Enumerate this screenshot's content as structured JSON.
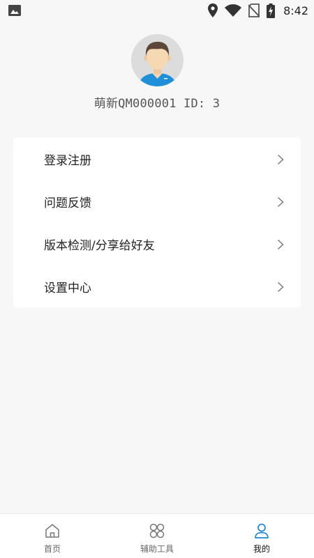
{
  "status_bar": {
    "time": "8:42",
    "icons": [
      "image-icon",
      "location-icon",
      "wifi-icon",
      "no-sim-icon",
      "battery-charging-icon"
    ]
  },
  "profile": {
    "name": "萌新QM000001 ID: 3",
    "avatar": "avatar-icon"
  },
  "menu": {
    "items": [
      {
        "label": "登录注册",
        "icon": "chevron-right-icon"
      },
      {
        "label": "问题反馈",
        "icon": "chevron-right-icon"
      },
      {
        "label": "版本检测/分享给好友",
        "icon": "chevron-right-icon"
      },
      {
        "label": "设置中心",
        "icon": "chevron-right-icon"
      }
    ]
  },
  "bottom_nav": {
    "items": [
      {
        "label": "首页",
        "icon": "home-icon",
        "active": false
      },
      {
        "label": "辅助工具",
        "icon": "tools-icon",
        "active": false
      },
      {
        "label": "我的",
        "icon": "user-icon",
        "active": true
      }
    ]
  },
  "colors": {
    "background": "#f7f7f7",
    "card": "#ffffff",
    "accent": "#1a8ad6",
    "text_primary": "#222222",
    "text_secondary": "#666666"
  }
}
